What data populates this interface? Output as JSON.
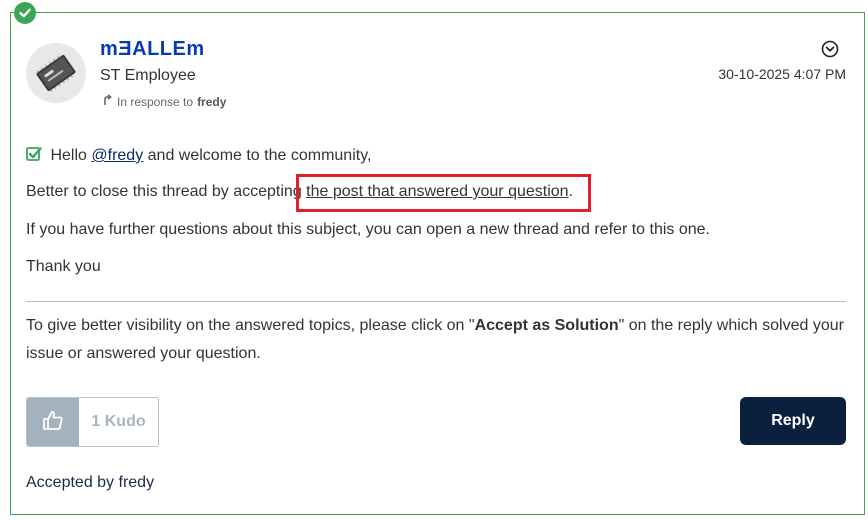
{
  "post": {
    "author": "mƎALLEm",
    "rank": "ST Employee",
    "in_response_prefix": "In response to",
    "in_response_user": "fredy",
    "date": "30-10-2025 4:07 PM"
  },
  "body": {
    "greeting_prefix": "Hello",
    "mention": "@fredy",
    "greeting_suffix": "and welcome to the community,",
    "close_prefix": "Better to close this thread by accepting",
    "close_link": "the post that answered your question",
    "close_suffix": ".",
    "further": "If you have further questions about this subject, you can open a new thread and refer to this one.",
    "thanks": "Thank you"
  },
  "footnote": {
    "prefix": "To give better visibility on the answered topics, please click on \"",
    "bold": "Accept as Solution",
    "suffix": "\" on the reply which solved your issue or answered your question."
  },
  "actions": {
    "kudo_label": "1 Kudo",
    "reply_label": "Reply"
  },
  "accepted_by": "Accepted by fredy",
  "colors": {
    "accent_green": "#3aa655",
    "author_blue": "#0a3ab0",
    "reply_navy": "#0b1f3f",
    "highlight_red": "#e0202a"
  },
  "icons": {
    "solved": "check-circle-icon",
    "options": "chevron-down-circle-icon",
    "reply_arrow": "reply-arrow-icon",
    "checkbox": "checked-box-icon",
    "kudo": "thumbs-up-icon"
  }
}
